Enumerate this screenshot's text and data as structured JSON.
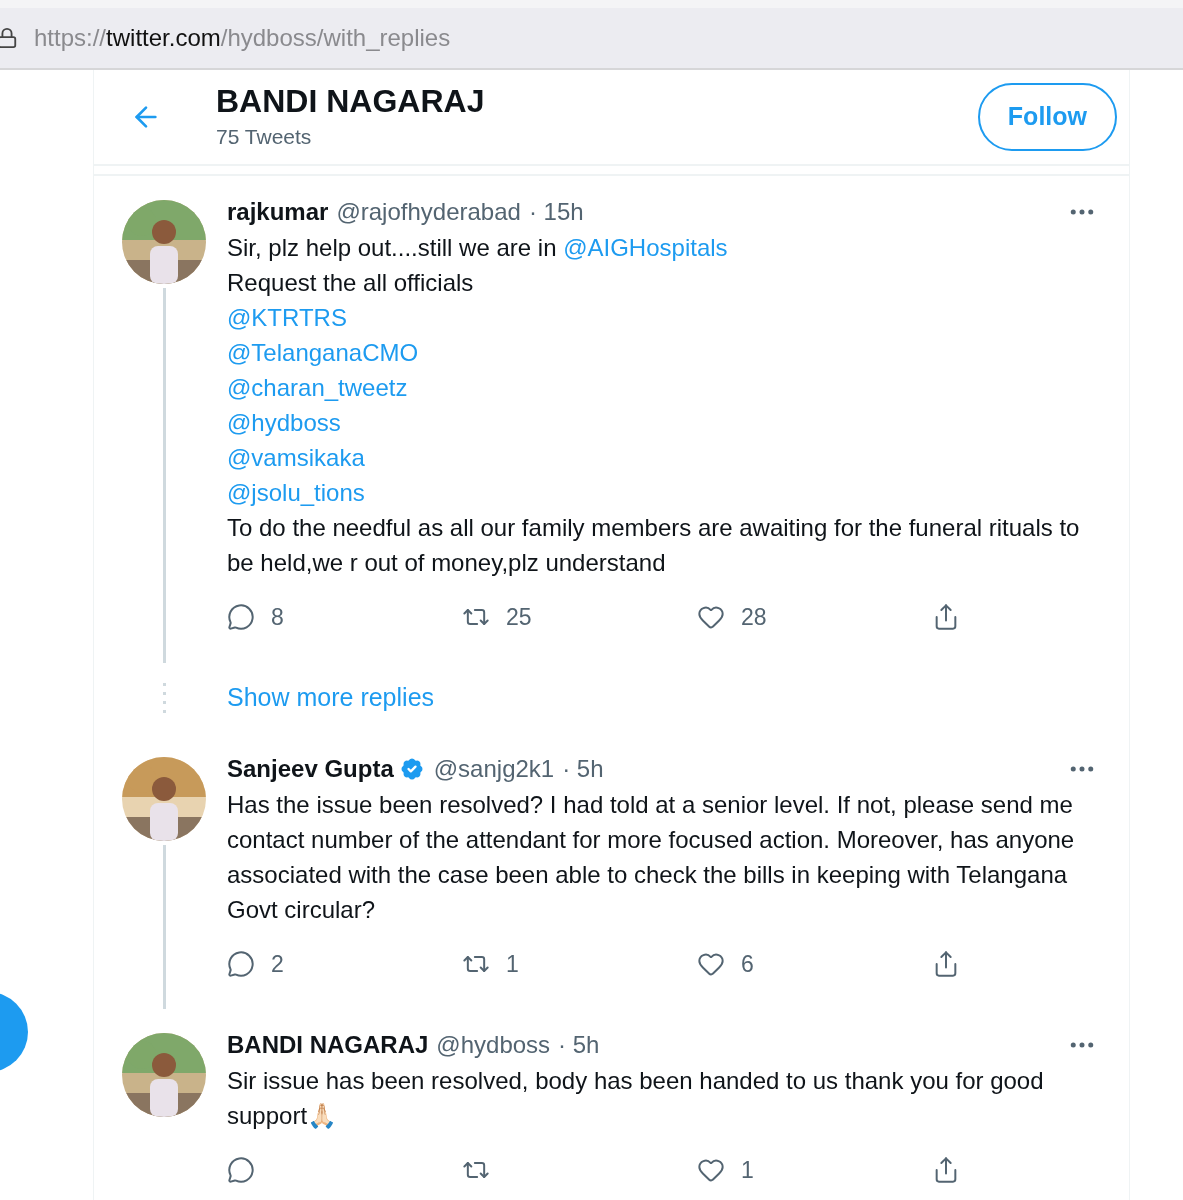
{
  "address_bar": {
    "scheme": "https://",
    "host": "twitter.com",
    "path": "/hydboss/with_replies"
  },
  "header": {
    "title": "BANDI NAGARAJ",
    "subtitle": "75 Tweets",
    "button": "Follow"
  },
  "tweets": [
    {
      "name": "rajkumar",
      "verified": false,
      "handle": "@rajofhyderabad",
      "time": "· 15h",
      "thread_below": true,
      "lines": [
        {
          "parts": [
            {
              "kind": "text",
              "text": "Sir, plz help out....still we are in "
            },
            {
              "kind": "mention",
              "text": "@AIGHospitals"
            }
          ]
        },
        {
          "parts": [
            {
              "kind": "text",
              "text": "Request the all officials"
            }
          ]
        },
        {
          "parts": [
            {
              "kind": "mention",
              "text": "@KTRTRS"
            }
          ]
        },
        {
          "parts": [
            {
              "kind": "mention",
              "text": "@TelanganaCMO"
            }
          ]
        },
        {
          "parts": [
            {
              "kind": "mention",
              "text": "@charan_tweetz"
            }
          ]
        },
        {
          "parts": [
            {
              "kind": "mention",
              "text": "@hydboss"
            }
          ]
        },
        {
          "parts": [
            {
              "kind": "mention",
              "text": "@vamsikaka"
            }
          ]
        },
        {
          "parts": [
            {
              "kind": "mention",
              "text": "@jsolu_tions"
            }
          ]
        },
        {
          "parts": [
            {
              "kind": "text",
              "text": "To do the needful as all our family members are awaiting for the funeral rituals to be held,we r out of money,plz understand"
            }
          ]
        }
      ],
      "replies": "8",
      "retweets": "25",
      "likes": "28"
    },
    {
      "kind": "show_more",
      "text": "Show more replies"
    },
    {
      "name": "Sanjeev Gupta",
      "verified": true,
      "handle": "@sanjg2k1",
      "time": "· 5h",
      "thread_below": true,
      "lines": [
        {
          "parts": [
            {
              "kind": "text",
              "text": "Has the issue been resolved? I had told at a senior level. If not, please send me contact number of the attendant for more focused action. Moreover, has anyone associated with the case been able to check the bills in keeping with Telangana Govt circular?"
            }
          ]
        }
      ],
      "replies": "2",
      "retweets": "1",
      "likes": "6"
    },
    {
      "name": "BANDI NAGARAJ",
      "verified": false,
      "handle": "@hydboss",
      "time": "· 5h",
      "thread_below": false,
      "lines": [
        {
          "parts": [
            {
              "kind": "text",
              "text": "Sir issue has been resolved, body has been handed to us thank you for good support🙏🏻"
            }
          ]
        }
      ],
      "likes": "1"
    }
  ]
}
